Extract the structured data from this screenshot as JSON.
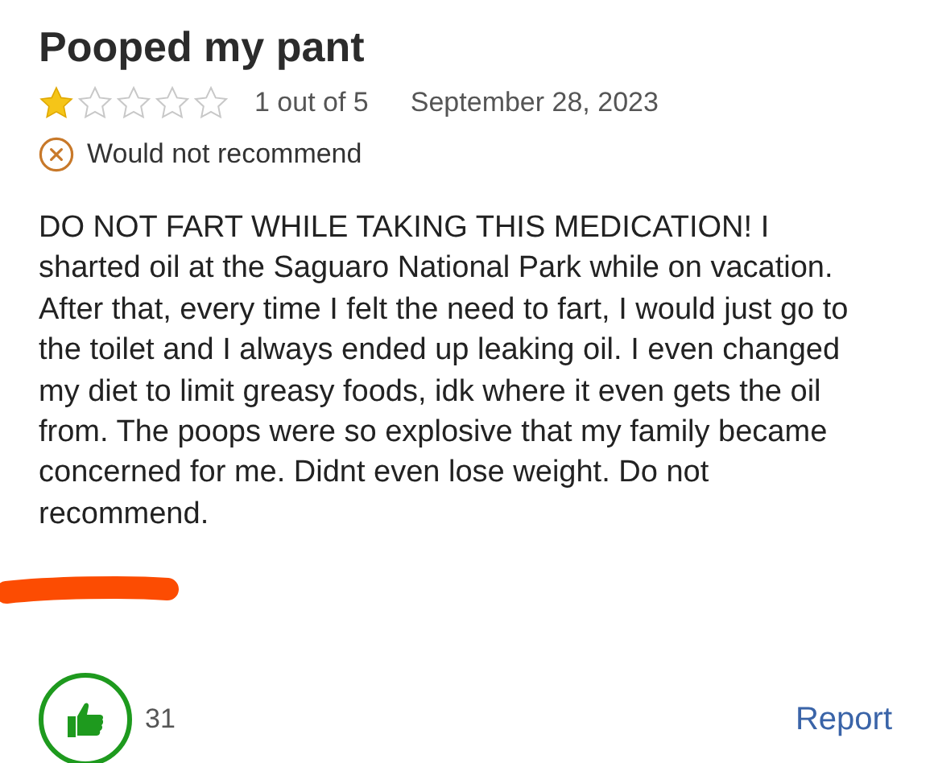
{
  "review": {
    "title": "Pooped my pant",
    "stars": 1,
    "rating_text": "1 out of 5",
    "date": "September 28, 2023",
    "recommendation": "Would not recommend",
    "body": "DO NOT FART WHILE TAKING THIS MEDICATION! I sharted oil at the Saguaro National Park while on vacation. After that, every time I felt the need to fart, I would just go to the toilet and I always ended up leaking oil. I even changed my diet to limit greasy foods, idk where it even gets the oil from. The poops were so explosive that my family became concerned for me. Didnt even lose weight. Do not recommend.",
    "helpful_count": "31",
    "report": "Report"
  }
}
